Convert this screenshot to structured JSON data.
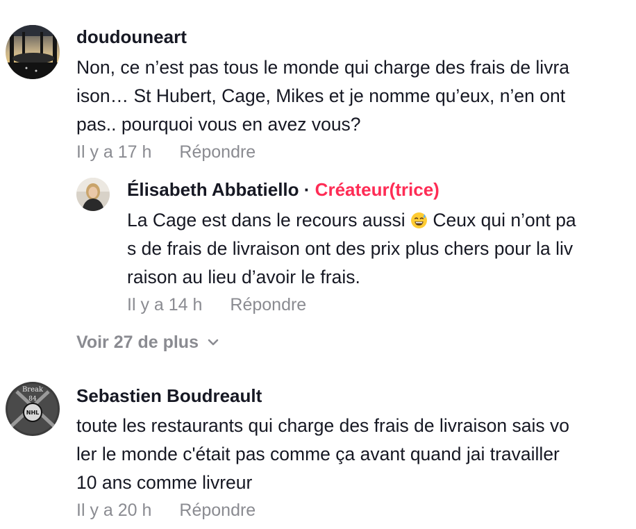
{
  "comments": [
    {
      "username": "doudouneart",
      "text_lines": [
        "Non, ce n’est pas tous le monde qui charge des frais de livra",
        "ison… St Hubert, Cage, Mikes et je nomme qu’eux, n’en ont",
        "pas.. pourquoi vous en avez vous?"
      ],
      "time": "Il y a 17 h",
      "reply_label": "Répondre",
      "replies": [
        {
          "username": "Élisabeth Abbatiello",
          "separator": "·",
          "badge": "Créateur(trice)",
          "text_before_emoji": "La Cage est dans le recours aussi ",
          "emoji_icon": "sweat-smile-emoji",
          "text_after_emoji": " Ceux qui n’ont pa",
          "text_lines": [
            "s de frais de livraison ont des prix plus chers pour la liv",
            "raison au lieu d’avoir le frais."
          ],
          "time": "Il y a 14 h",
          "reply_label": "Répondre"
        }
      ],
      "see_more": "Voir 27 de plus"
    },
    {
      "username": "Sebastien Boudreault",
      "text_lines": [
        "toute les restaurants qui charge des frais de livraison sais vo",
        "ler le monde c'était pas comme ça avant quand jai travailler",
        "10 ans comme livreur"
      ],
      "avatar_text": [
        "Break",
        "84",
        "NHL"
      ],
      "time": "Il y a 20 h",
      "reply_label": "Répondre"
    }
  ],
  "colors": {
    "text": "#161823",
    "muted": "#8a8b91",
    "creator": "#fe2c55"
  }
}
